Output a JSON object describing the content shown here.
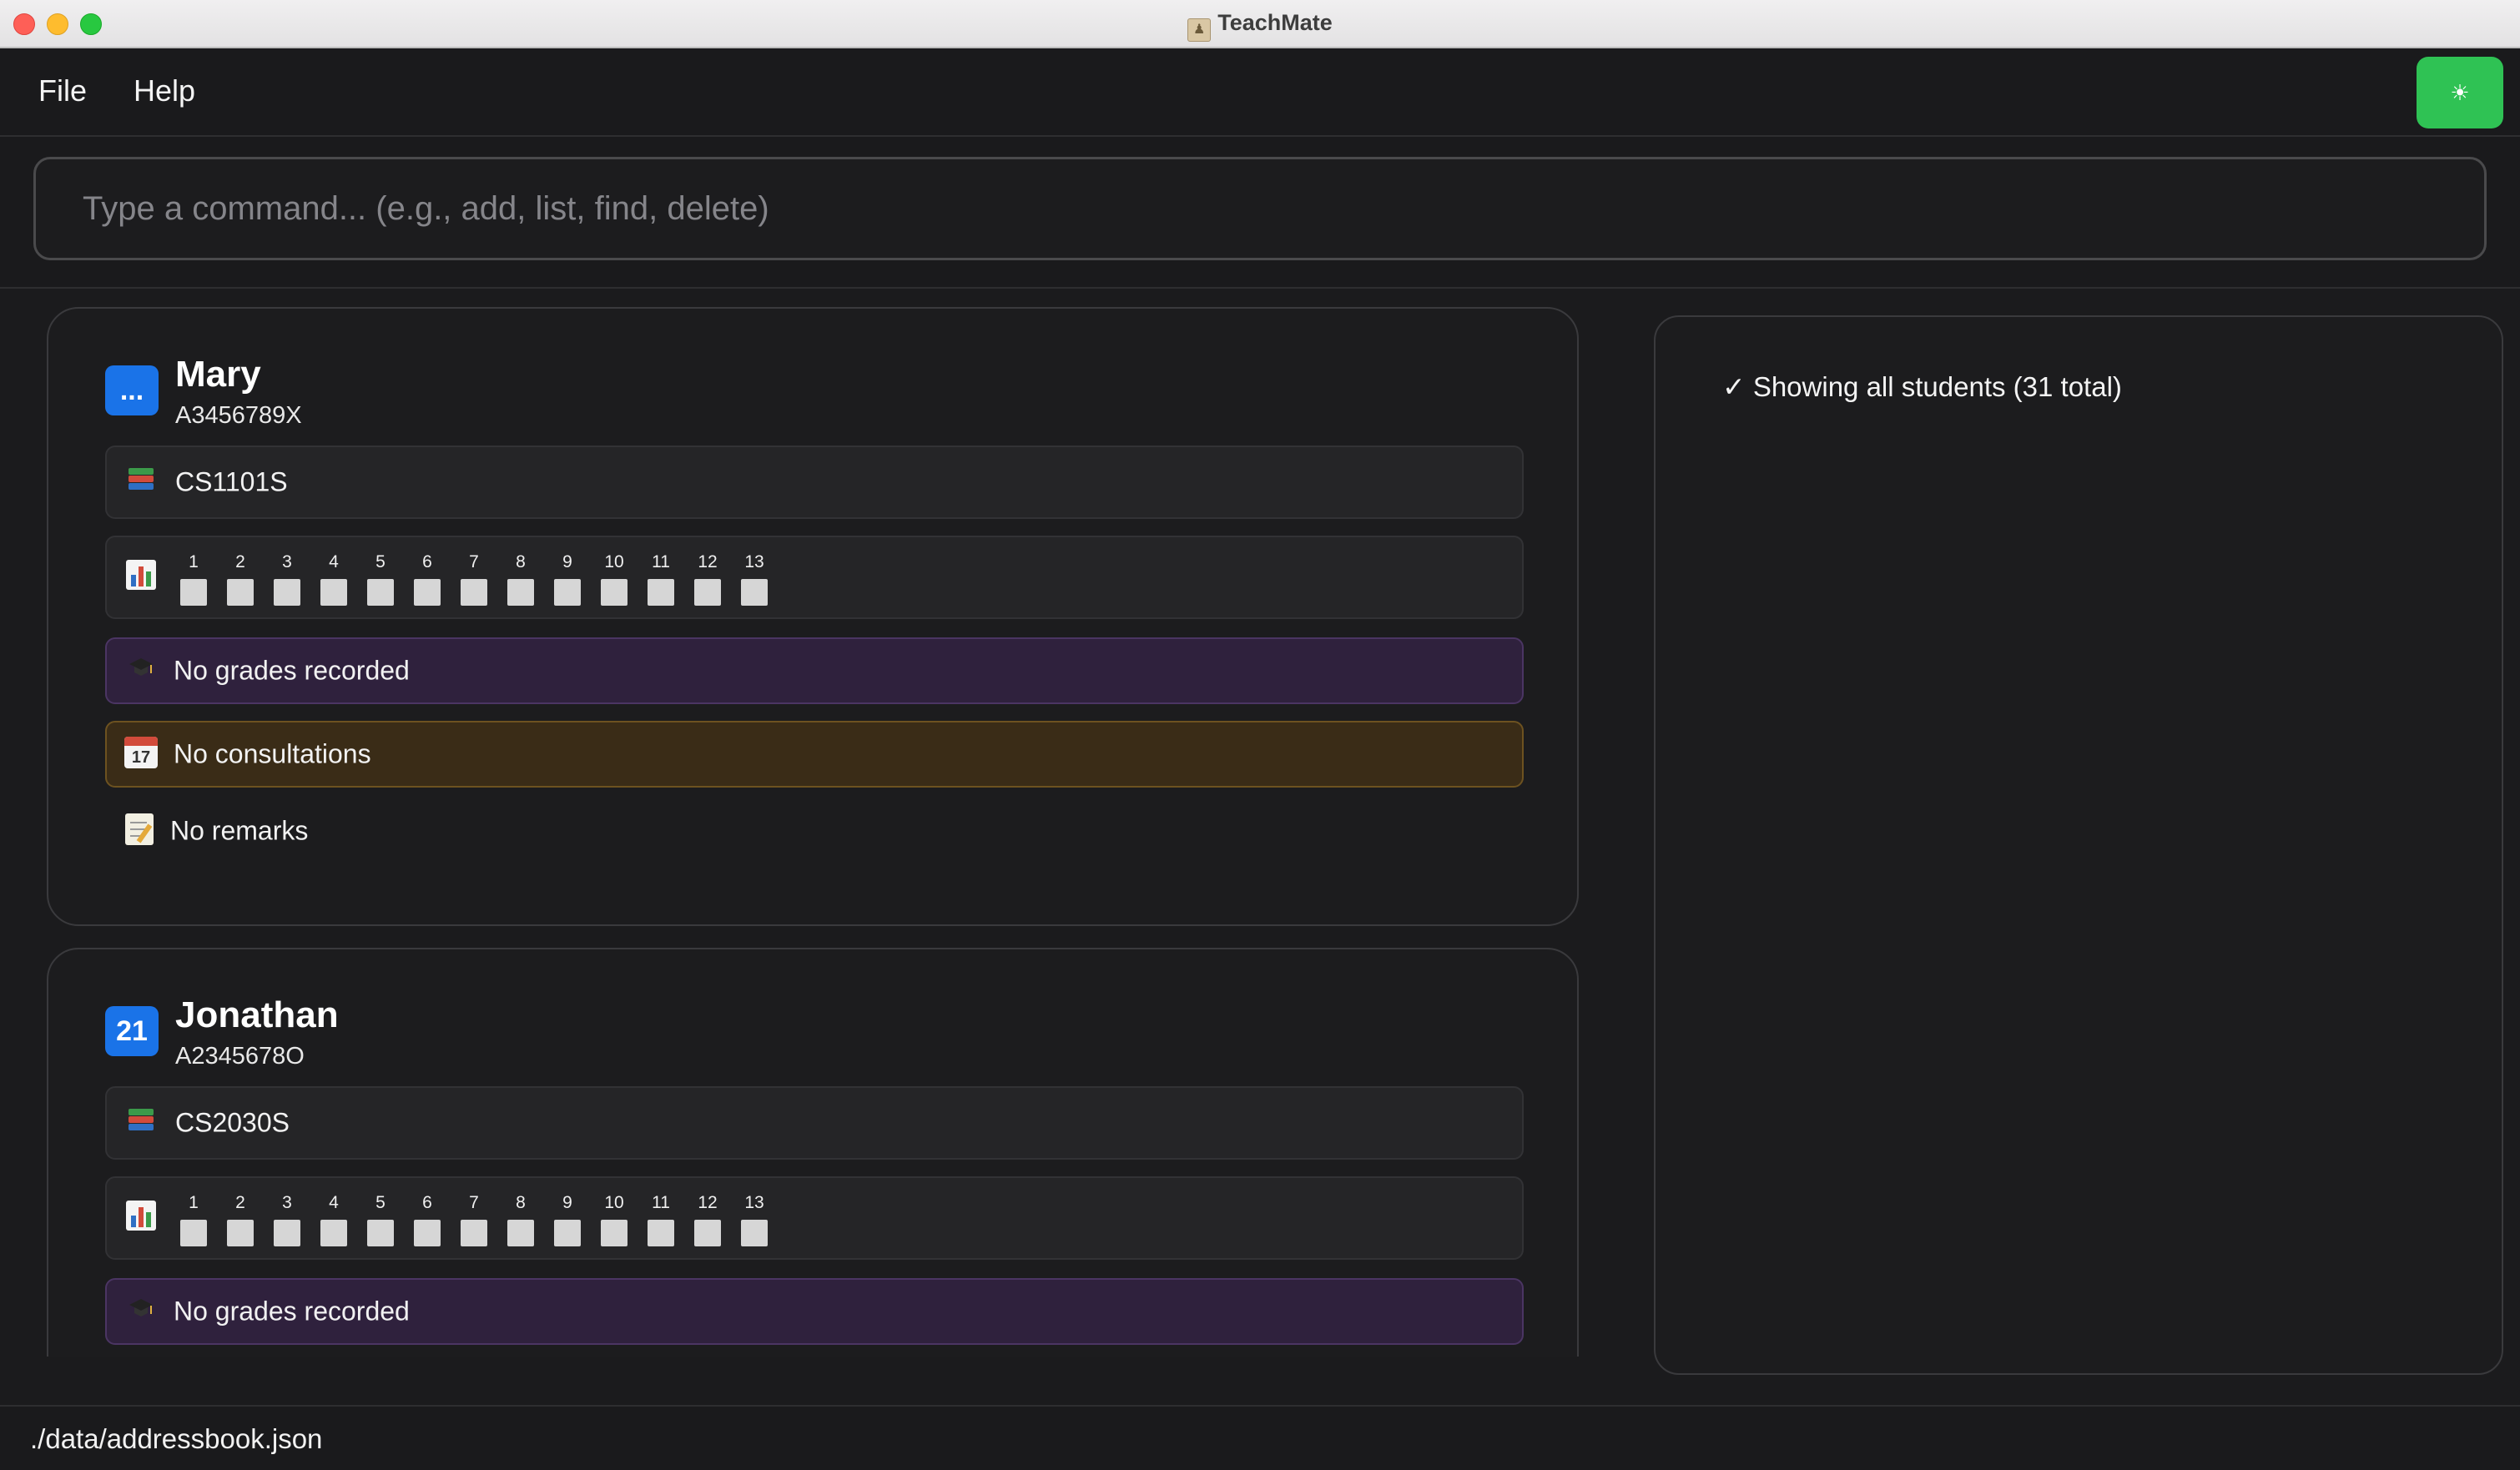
{
  "window": {
    "title": "TeachMate"
  },
  "menu": {
    "file": "File",
    "help": "Help",
    "theme_toggle": "☀"
  },
  "command": {
    "placeholder": "Type a command... (e.g., add, list, find, delete)",
    "value": ""
  },
  "students": [
    {
      "avatar": "...",
      "name": "Mary",
      "id": "A3456789X",
      "module": "CS1101S",
      "weeks": [
        "1",
        "2",
        "3",
        "4",
        "5",
        "6",
        "7",
        "8",
        "9",
        "10",
        "11",
        "12",
        "13"
      ],
      "grades": "No grades recorded",
      "consultations": "No consultations",
      "remarks": "No remarks"
    },
    {
      "avatar": "21",
      "name": "Jonathan",
      "id": "A2345678O",
      "module": "CS2030S",
      "weeks": [
        "1",
        "2",
        "3",
        "4",
        "5",
        "6",
        "7",
        "8",
        "9",
        "10",
        "11",
        "12",
        "13"
      ],
      "grades": "No grades recorded"
    }
  ],
  "result": {
    "message": "✓ Showing all students (31 total)"
  },
  "status": {
    "file_path": "./data/addressbook.json"
  },
  "colors": {
    "avatar": "#1a73e8",
    "theme_button": "#2fc254",
    "grades_bg": "#2f213d",
    "consult_bg": "#3a2c17"
  }
}
